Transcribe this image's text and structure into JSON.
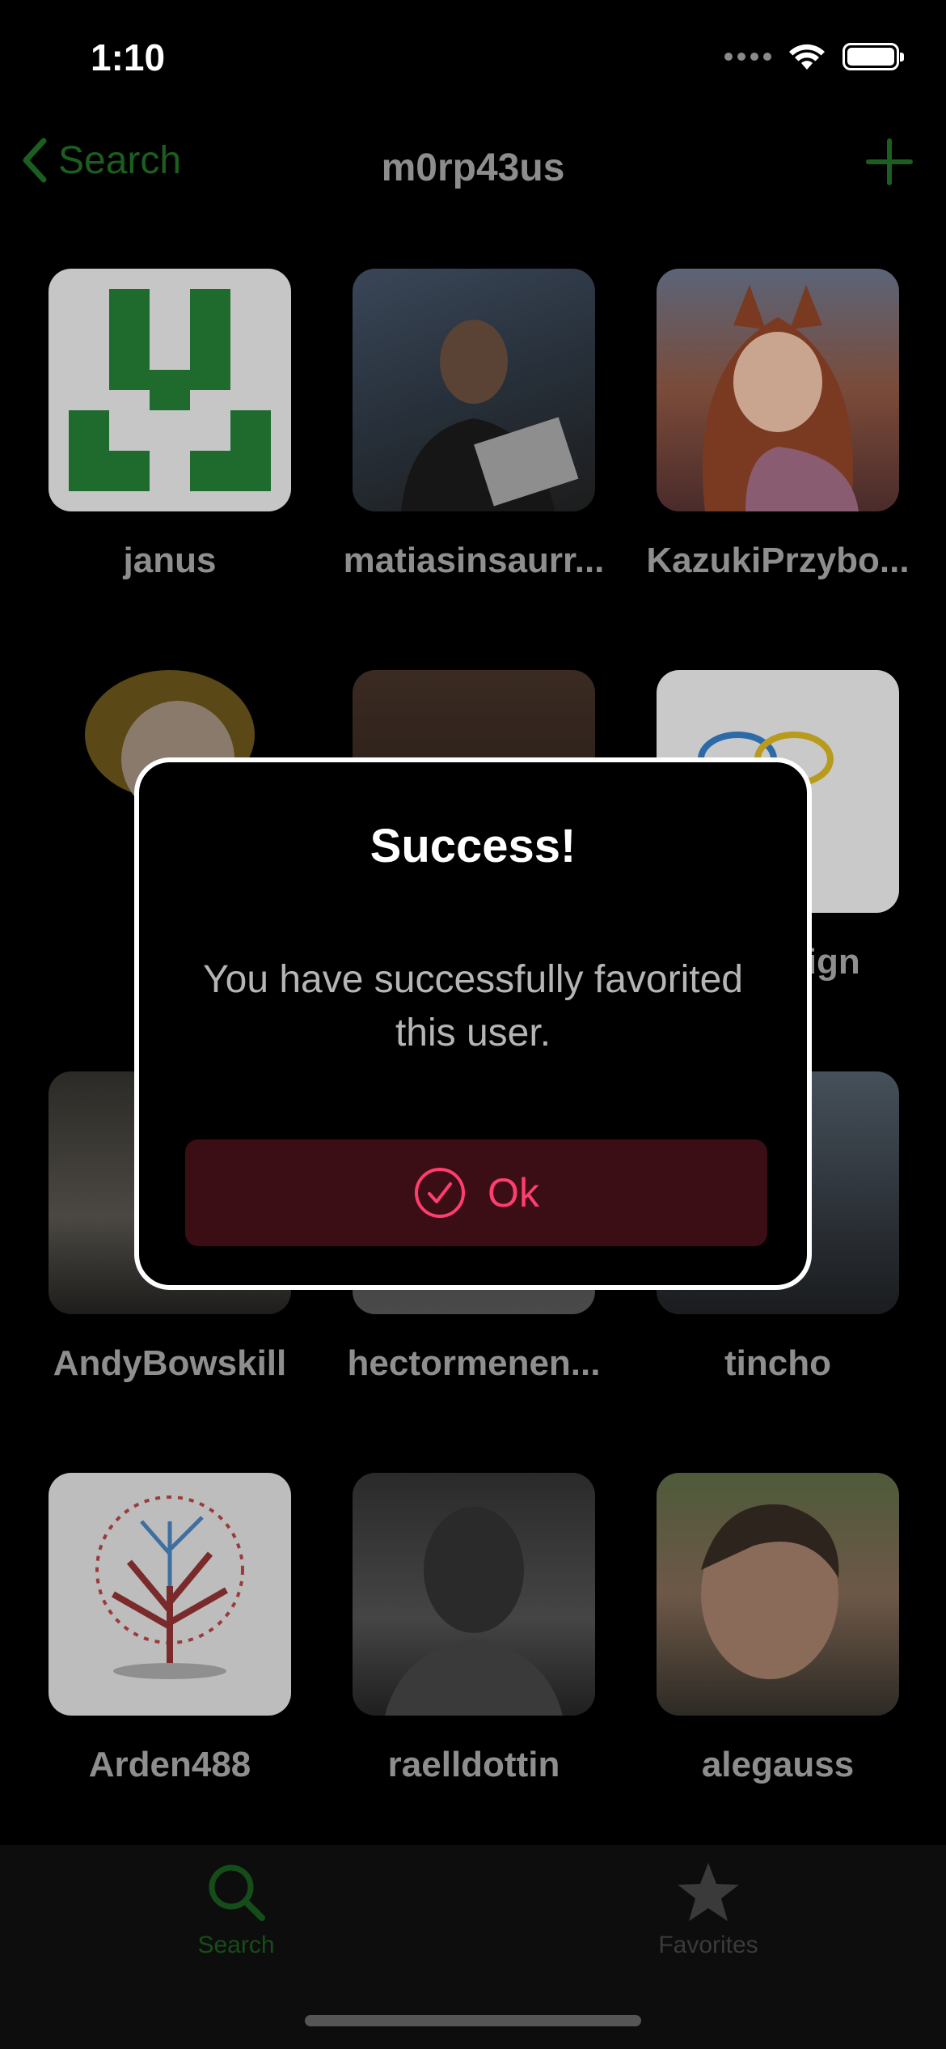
{
  "status_bar": {
    "time": "1:10"
  },
  "nav": {
    "back_label": "Search",
    "title": "m0rp43us"
  },
  "grid": {
    "users": [
      {
        "name": "janus",
        "avatar": "identicon"
      },
      {
        "name": "matiasinsaurr...",
        "avatar": "photo"
      },
      {
        "name": "KazukiPrzybo...",
        "avatar": "anime"
      },
      {
        "name": "",
        "avatar": "cartoon"
      },
      {
        "name": "",
        "avatar": "photo"
      },
      {
        "name": "design",
        "avatar": "logo"
      },
      {
        "name": "AndyBowskill",
        "avatar": "photo"
      },
      {
        "name": "hectormenen...",
        "avatar": "photo"
      },
      {
        "name": "tincho",
        "avatar": "photo"
      },
      {
        "name": "Arden488",
        "avatar": "tree"
      },
      {
        "name": "raelldottin",
        "avatar": "photo"
      },
      {
        "name": "alegauss",
        "avatar": "photo"
      }
    ]
  },
  "alert": {
    "title": "Success!",
    "message": "You have successfully favorited this user.",
    "ok_label": "Ok"
  },
  "tab_bar": {
    "tabs": [
      {
        "label": "Search",
        "icon": "magnifier-icon",
        "selected": true
      },
      {
        "label": "Favorites",
        "icon": "star-icon",
        "selected": false
      }
    ]
  },
  "colors": {
    "accent_green": "#1b5e20",
    "alert_button_bg": "#3b0e16",
    "alert_button_fg": "#ff3d6e",
    "alert_border": "#ffffff"
  }
}
